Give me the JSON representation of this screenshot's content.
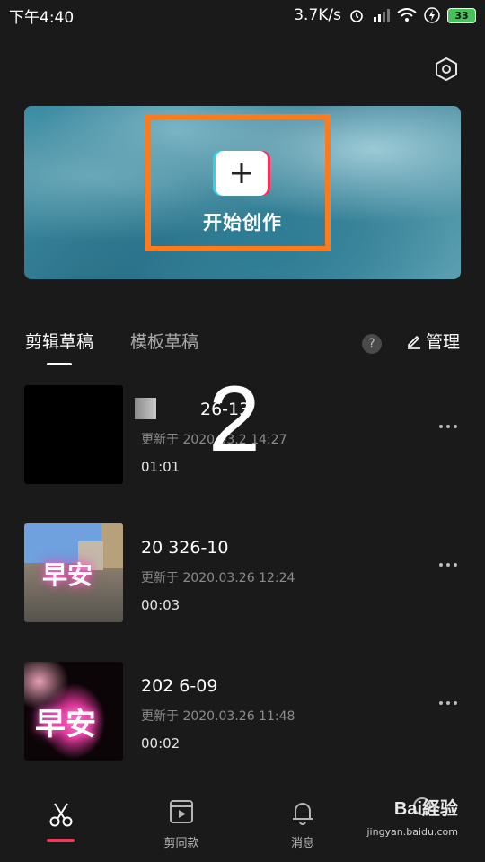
{
  "status_bar": {
    "time": "下午4:40",
    "network_speed": "3.7K/s",
    "battery": "33"
  },
  "banner": {
    "create_label": "开始创作"
  },
  "tabs": {
    "edit_drafts": "剪辑草稿",
    "template_drafts": "模板草稿",
    "help": "?",
    "manage": "管理"
  },
  "drafts": [
    {
      "name": "26-13",
      "updated": "更新于 2020.03.2  14:27",
      "duration": "01:01"
    },
    {
      "name": "20     326-10",
      "updated": "更新于 2020.03.26 12:24",
      "duration": "00:03"
    },
    {
      "name": "202    6-09",
      "updated": "更新于 2020.03.26 11:48",
      "duration": "00:02"
    }
  ],
  "overlay_number": "2",
  "thumbnail_text": "早安",
  "bottom_nav": {
    "templates": "剪同款",
    "messages": "消息"
  },
  "watermark": {
    "logo": "Bai経验",
    "url": "jingyan.baidu.com"
  },
  "colors": {
    "accent": "#f03a5a",
    "highlight": "#ff7a1a",
    "background": "#1a1a1a"
  }
}
